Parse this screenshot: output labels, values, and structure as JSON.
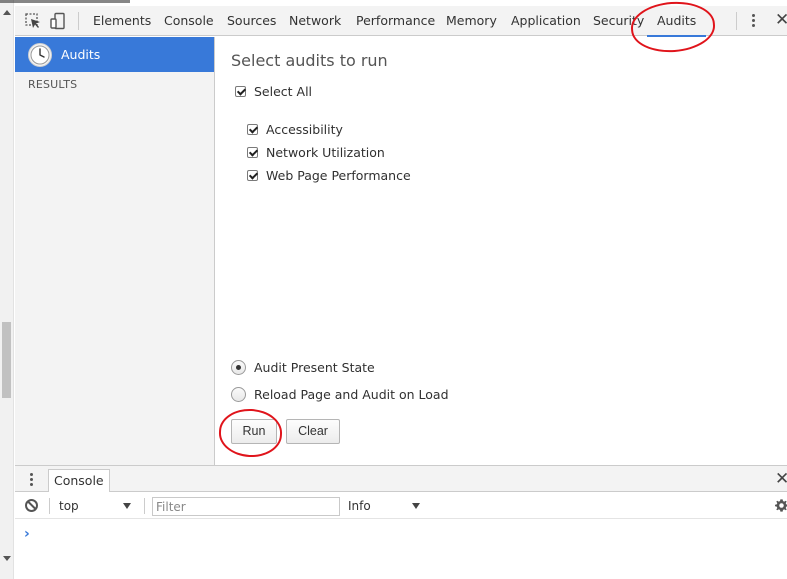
{
  "devtools": {
    "tabs": [
      "Elements",
      "Console",
      "Sources",
      "Network",
      "Performance",
      "Memory",
      "Application",
      "Security",
      "Audits"
    ],
    "active_tab": "Audits",
    "accent_color": "#3879d9",
    "annotation_color": "#e0141b"
  },
  "icons": {
    "inspect": "inspect-element-icon",
    "device": "device-toolbar-icon",
    "menu": "more-vertical-icon",
    "close": "close-icon",
    "audits": "clock-icon",
    "clear": "clear-console-icon",
    "settings": "gear-icon"
  },
  "sidebar": {
    "active_item": "Audits",
    "results_label": "RESULTS"
  },
  "main": {
    "title": "Select audits to run",
    "select_all": {
      "label": "Select All",
      "checked": true
    },
    "audits": [
      {
        "label": "Accessibility",
        "checked": true
      },
      {
        "label": "Network Utilization",
        "checked": true
      },
      {
        "label": "Web Page Performance",
        "checked": true
      }
    ],
    "modes": [
      {
        "label": "Audit Present State",
        "selected": true
      },
      {
        "label": "Reload Page and Audit on Load",
        "selected": false
      }
    ],
    "run_label": "Run",
    "clear_label": "Clear"
  },
  "drawer": {
    "tab_label": "Console",
    "context": "top",
    "filter_placeholder": "Filter",
    "level": "Info",
    "prompt": "›",
    "close_glyph": "✕"
  }
}
